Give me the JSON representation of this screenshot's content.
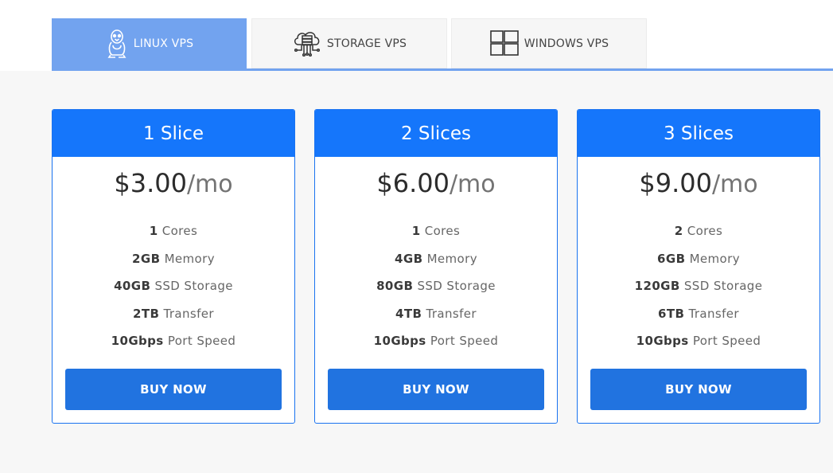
{
  "tabs": [
    {
      "label": "LINUX VPS",
      "icon": "penguin-icon",
      "active": true
    },
    {
      "label": "STORAGE VPS",
      "icon": "cloud-server-icon",
      "active": false
    },
    {
      "label": "WINDOWS VPS",
      "icon": "windows-icon",
      "active": false
    }
  ],
  "plans": [
    {
      "name": "1 Slice",
      "price": "$3.00",
      "unit": "/mo",
      "features": [
        {
          "value": "1",
          "label": "Cores"
        },
        {
          "value": "2GB",
          "label": "Memory"
        },
        {
          "value": "40GB",
          "label": "SSD Storage"
        },
        {
          "value": "2TB",
          "label": "Transfer"
        },
        {
          "value": "10Gbps",
          "label": "Port Speed"
        }
      ],
      "button": "BUY NOW"
    },
    {
      "name": "2 Slices",
      "price": "$6.00",
      "unit": "/mo",
      "features": [
        {
          "value": "1",
          "label": "Cores"
        },
        {
          "value": "4GB",
          "label": "Memory"
        },
        {
          "value": "80GB",
          "label": "SSD Storage"
        },
        {
          "value": "4TB",
          "label": "Transfer"
        },
        {
          "value": "10Gbps",
          "label": "Port Speed"
        }
      ],
      "button": "BUY NOW"
    },
    {
      "name": "3 Slices",
      "price": "$9.00",
      "unit": "/mo",
      "features": [
        {
          "value": "2",
          "label": "Cores"
        },
        {
          "value": "6GB",
          "label": "Memory"
        },
        {
          "value": "120GB",
          "label": "SSD Storage"
        },
        {
          "value": "6TB",
          "label": "Transfer"
        },
        {
          "value": "10Gbps",
          "label": "Port Speed"
        }
      ],
      "button": "BUY NOW"
    }
  ],
  "colors": {
    "header_blue": "#1576fb",
    "button_blue": "#2173e0",
    "active_tab": "#72a3ef",
    "page_bg": "#f7f7f7"
  }
}
